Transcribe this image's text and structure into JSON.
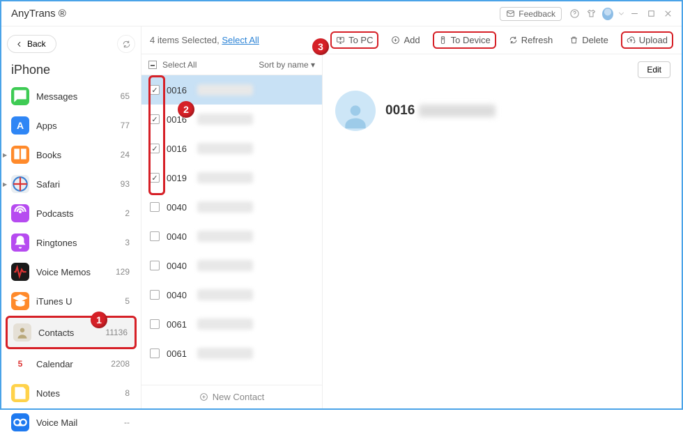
{
  "titlebar": {
    "brand": "AnyTrans ®",
    "feedback_label": "Feedback"
  },
  "sidebar": {
    "back_label": "Back",
    "device_title": "iPhone",
    "items": [
      {
        "label": "Messages",
        "count": "65",
        "color": "#3ecb54",
        "glyph": "speech"
      },
      {
        "label": "Apps",
        "count": "77",
        "color": "#2f86f5",
        "glyph": "A"
      },
      {
        "label": "Books",
        "count": "24",
        "color": "#ff8a2b",
        "glyph": "book",
        "caret": true
      },
      {
        "label": "Safari",
        "count": "93",
        "color": "#e9eef2",
        "glyph": "compass",
        "caret": true
      },
      {
        "label": "Podcasts",
        "count": "2",
        "color": "#b64bf0",
        "glyph": "podcast"
      },
      {
        "label": "Ringtones",
        "count": "3",
        "color": "#b64bf0",
        "glyph": "bell"
      },
      {
        "label": "Voice Memos",
        "count": "129",
        "color": "#1a1a1a",
        "glyph": "wave"
      },
      {
        "label": "iTunes U",
        "count": "5",
        "color": "#ff8a2b",
        "glyph": "grad"
      },
      {
        "label": "Contacts",
        "count": "11136",
        "color": "#e5e0d6",
        "glyph": "contact",
        "active": true
      },
      {
        "label": "Calendar",
        "count": "2208",
        "color": "#ffffff",
        "glyph": "cal"
      },
      {
        "label": "Notes",
        "count": "8",
        "color": "#ffd24a",
        "glyph": "note"
      },
      {
        "label": "Voice Mail",
        "count": "--",
        "color": "#1f7af0",
        "glyph": "vm"
      }
    ]
  },
  "toolbar": {
    "selected_prefix": "4 items Selected, ",
    "select_all": "Select All",
    "to_pc": "To PC",
    "add": "Add",
    "to_device": "To Device",
    "refresh": "Refresh",
    "delete": "Delete",
    "upload": "Upload"
  },
  "list": {
    "header_select_all": "Select All",
    "sort_label": "Sort by name ▾",
    "new_contact": "New Contact",
    "rows": [
      {
        "num": "0016",
        "checked": true,
        "selected": true
      },
      {
        "num": "0016",
        "checked": true
      },
      {
        "num": "0016",
        "checked": true
      },
      {
        "num": "0019",
        "checked": true
      },
      {
        "num": "0040",
        "checked": false
      },
      {
        "num": "0040",
        "checked": false
      },
      {
        "num": "0040",
        "checked": false
      },
      {
        "num": "0040",
        "checked": false
      },
      {
        "num": "0061",
        "checked": false
      },
      {
        "num": "0061",
        "checked": false
      }
    ]
  },
  "detail": {
    "edit": "Edit",
    "name_prefix": "0016"
  },
  "annotations": {
    "badge1": "1",
    "badge2": "2",
    "badge3": "3"
  }
}
